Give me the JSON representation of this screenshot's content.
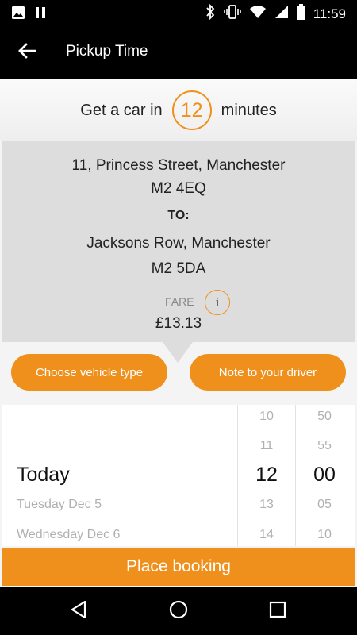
{
  "status_bar": {
    "time": "11:59",
    "left_icons": [
      "image-icon",
      "pause-icon"
    ],
    "right_icons": [
      "bluetooth-icon",
      "vibrate-icon",
      "wifi-icon",
      "signal-icon",
      "battery-icon"
    ]
  },
  "app_bar": {
    "title": "Pickup Time",
    "back_icon": "arrow-back-icon"
  },
  "eta": {
    "prefix": "Get a car in",
    "minutes": "12",
    "suffix": "minutes"
  },
  "trip": {
    "pickup_street": "11, Princess Street, Manchester",
    "pickup_postcode": "M2 4EQ",
    "to_label": "TO:",
    "dropoff_street": "Jacksons Row, Manchester",
    "dropoff_postcode": "M2 5DA",
    "fare_label": "FARE",
    "info_label": "i",
    "fare_value": "£13.13"
  },
  "actions": {
    "vehicle_type": "Choose vehicle type",
    "driver_note": "Note to your driver"
  },
  "picker": {
    "days": {
      "selected": "Today",
      "next": [
        "Tuesday Dec 5",
        "Wednesday Dec 6"
      ]
    },
    "hours": {
      "above": [
        "10",
        "11"
      ],
      "selected": "12",
      "below": [
        "13",
        "14"
      ]
    },
    "minutes": {
      "above": [
        "50",
        "55"
      ],
      "selected": "00",
      "below": [
        "05",
        "10"
      ]
    }
  },
  "place_booking": "Place booking",
  "nav_bar": {
    "icons": [
      "back-triangle-icon",
      "home-circle-icon",
      "recents-square-icon"
    ]
  },
  "colors": {
    "accent": "#ef901c",
    "bar": "#000000",
    "card": "#dddddd"
  }
}
